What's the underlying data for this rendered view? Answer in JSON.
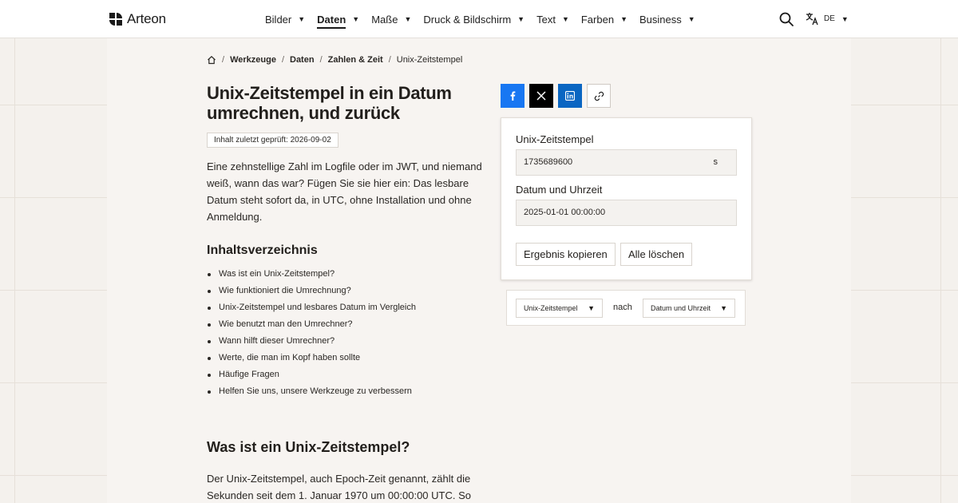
{
  "header": {
    "brand": "Arteon",
    "nav": [
      {
        "label": "Bilder"
      },
      {
        "label": "Daten"
      },
      {
        "label": "Maße"
      },
      {
        "label": "Druck & Bildschirm"
      },
      {
        "label": "Text"
      },
      {
        "label": "Farben"
      },
      {
        "label": "Business"
      }
    ],
    "active_nav": "Daten",
    "caret": "▼",
    "language": "DE"
  },
  "breadcrumb": [
    "Werkzeuge",
    "Daten",
    "Zahlen & Zeit",
    "Unix-Zeitstempel"
  ],
  "breadcrumb_sep": "/",
  "page": {
    "title": "Unix-Zeitstempel in ein Datum umrechnen, und zurück",
    "checked": "Inhalt zuletzt geprüft: 2026-09-02",
    "intro": "Eine zehnstellige Zahl im Logfile oder im JWT, und niemand weiß, wann das war? Fügen Sie sie hier ein: Das lesbare Datum steht sofort da, in UTC, ohne Installation und ohne Anmeldung."
  },
  "toc": {
    "heading": "Inhaltsverzeichnis",
    "items": [
      "Was ist ein Unix-Zeitstempel?",
      "Wie funktioniert die Umrechnung?",
      "Unix-Zeitstempel und lesbares Datum im Vergleich",
      "Wie benutzt man den Umrechner?",
      "Wann hilft dieser Umrechner?",
      "Werte, die man im Kopf haben sollte",
      "Häufige Fragen",
      "Helfen Sie uns, unsere Werkzeuge zu verbessern"
    ]
  },
  "section": {
    "heading": "Was ist ein Unix-Zeitstempel?",
    "body": "Der Unix-Zeitstempel, auch Epoch-Zeit genannt, zählt die Sekunden seit dem 1. Januar 1970 um 00:00:00 UTC. So"
  },
  "share": {
    "icons": [
      "facebook-icon",
      "x-icon",
      "linkedin-icon",
      "link-icon"
    ],
    "colors": {
      "facebook": "#1877f2",
      "x": "#000000",
      "linkedin": "#0a66c2"
    }
  },
  "converter": {
    "timestamp_label": "Unix-Zeitstempel",
    "timestamp_value": "1735689600",
    "timestamp_unit": "s",
    "datetime_label": "Datum und Uhrzeit",
    "datetime_value": "2025-01-01 00:00:00",
    "copy_button": "Ergebnis kopieren",
    "clear_button": "Alle löschen"
  },
  "direction": {
    "from": "Unix-Zeitstempel",
    "separator": "nach",
    "to": "Datum und Uhrzeit",
    "caret": "▼"
  }
}
